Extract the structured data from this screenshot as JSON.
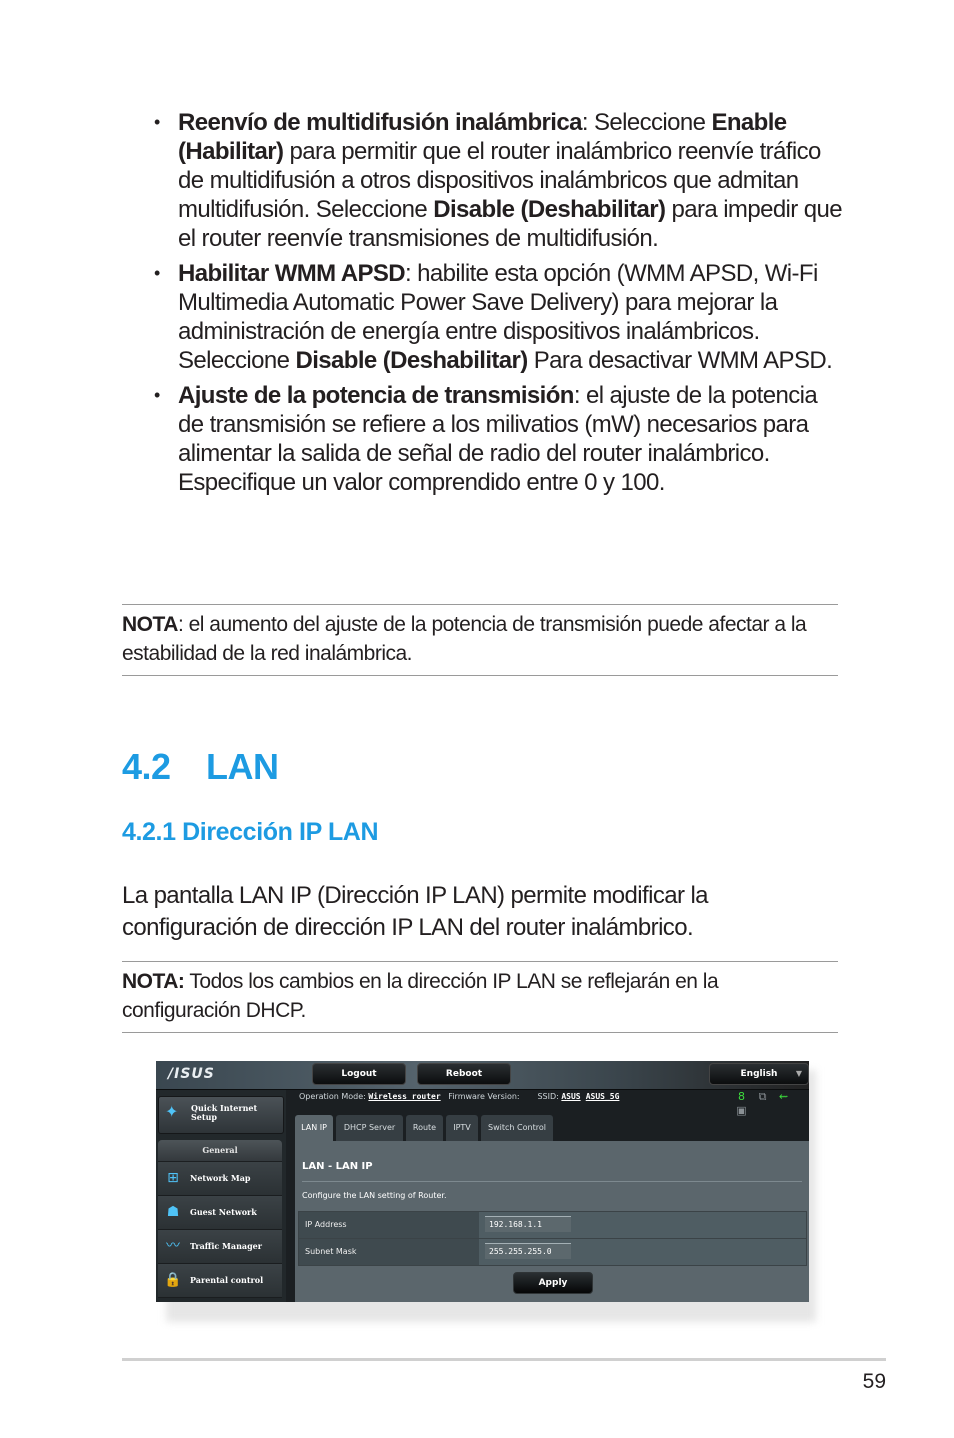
{
  "bullets": [
    {
      "bold_lead": "Reenvío de multidifusión inalámbrica",
      "parts": [
        {
          "t": ":  Seleccione ",
          "b": false
        },
        {
          "t": "Enable (Habilitar)",
          "b": true
        },
        {
          "t": " para permitir que el router inalámbrico reenvíe tráfico de multidifusión a otros dispositivos inalámbricos que admitan multidifusión. Seleccione ",
          "b": false
        },
        {
          "t": "Disable (Deshabilitar)",
          "b": true
        },
        {
          "t": " para impedir que el router reenvíe transmisiones de multidifusión.",
          "b": false
        }
      ]
    },
    {
      "bold_lead": "Habilitar WMM APSD",
      "parts": [
        {
          "t": ":  habilite esta opción (WMM APSD, Wi-Fi Multimedia Automatic Power Save Delivery) para mejorar la administración de energía entre dispositivos inalámbricos. Seleccione ",
          "b": false
        },
        {
          "t": "Disable (Deshabilitar)",
          "b": true
        },
        {
          "t": " Para desactivar WMM APSD.",
          "b": false
        }
      ]
    },
    {
      "bold_lead": "Ajuste de la potencia de transmisión",
      "parts": [
        {
          "t": ":  el ajuste de la potencia de transmisión se refiere a los milivatios (mW) necesarios para alimentar la salida de señal de radio del router inalámbrico. Especifique un valor comprendido entre 0 y 100.",
          "b": false
        }
      ]
    }
  ],
  "note1": {
    "label": "NOTA",
    "text": ":  el aumento del ajuste de la potencia de transmisión puede afectar a la estabilidad de la red inalámbrica."
  },
  "section": {
    "number": "4.2",
    "title": "LAN"
  },
  "subsection": {
    "title": "4.2.1 Dirección IP LAN"
  },
  "intro": "La pantalla LAN IP (Dirección IP LAN) permite modificar la configuración de dirección IP LAN del router inalámbrico.",
  "note2": {
    "label": "NOTA:",
    "text": "  Todos los cambios en la dirección IP LAN se reflejarán en la configuración DHCP."
  },
  "router": {
    "logo": "/ISUS",
    "logout": "Logout",
    "reboot": "Reboot",
    "language": "English",
    "quick_setup": "Quick Internet Setup",
    "menu_header": "General",
    "menu": [
      {
        "label": "Network Map",
        "icon": "network-map-icon",
        "glyph": "⊞"
      },
      {
        "label": "Guest Network",
        "icon": "guest-network-icon",
        "glyph": "☗"
      },
      {
        "label": "Traffic Manager",
        "icon": "traffic-manager-icon",
        "glyph": "〰"
      },
      {
        "label": "Parental control",
        "icon": "lock-icon",
        "glyph": "🔒"
      }
    ],
    "status": {
      "op_mode_label": "Operation Mode:",
      "op_mode": "Wireless router",
      "firmware_label": "Firmware Version:",
      "ssid_label": "SSID:",
      "ssid1": "ASUS",
      "ssid2": "ASUS_5G"
    },
    "status_icons": [
      {
        "name": "clients-icon",
        "glyph": "8",
        "color": "#3ddc3d"
      },
      {
        "name": "devices-icon",
        "glyph": "⧉",
        "color": "#8a9095"
      },
      {
        "name": "usb-icon",
        "glyph": "⇜",
        "color": "#3ddc3d"
      },
      {
        "name": "printer-icon",
        "glyph": "▣",
        "color": "#8a9095"
      }
    ],
    "tabs": [
      "LAN IP",
      "DHCP Server",
      "Route",
      "IPTV",
      "Switch Control"
    ],
    "active_tab": "LAN IP",
    "panel_title": "LAN - LAN IP",
    "panel_desc": "Configure the LAN setting of Router.",
    "fields": [
      {
        "label": "IP Address",
        "value": "192.168.1.1"
      },
      {
        "label": "Subnet Mask",
        "value": "255.255.255.0"
      }
    ],
    "apply": "Apply"
  },
  "page_number": "59"
}
